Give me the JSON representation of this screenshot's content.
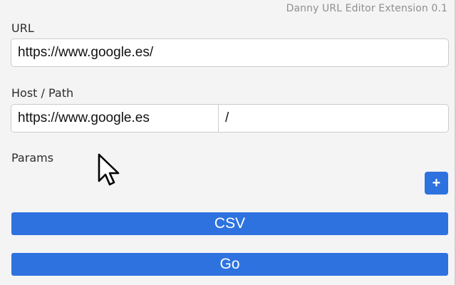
{
  "header": {
    "version_text": "Danny URL Editor Extension 0.1"
  },
  "url_section": {
    "label": "URL",
    "value": "https://www.google.es/"
  },
  "host_path_section": {
    "label": "Host / Path",
    "host_value": "https://www.google.es",
    "path_value": "/"
  },
  "params_section": {
    "label": "Params",
    "add_button_label": "+"
  },
  "buttons": {
    "csv_label": "CSV",
    "go_label": "Go"
  },
  "colors": {
    "accent": "#2d72df",
    "background": "#f4f4f4"
  }
}
